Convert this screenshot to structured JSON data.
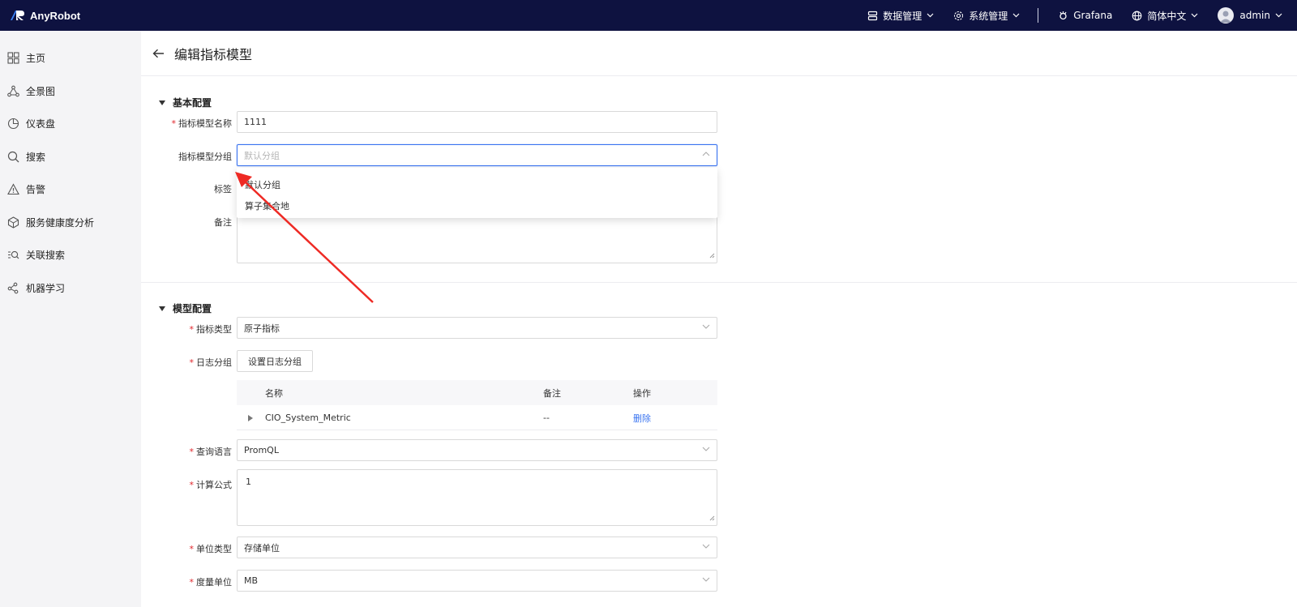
{
  "app": {
    "name": "AnyRobot",
    "brand_color": "#0e1240",
    "accent_color": "#3a74f0",
    "required_color": "#e0262b"
  },
  "topnav": {
    "data_mgmt": "数据管理",
    "sys_mgmt": "系统管理",
    "grafana": "Grafana",
    "language": "简体中文",
    "user": "admin"
  },
  "sidebar": {
    "items": [
      {
        "label": "主页",
        "icon": "grid-icon"
      },
      {
        "label": "全景图",
        "icon": "topology-icon"
      },
      {
        "label": "仪表盘",
        "icon": "pie-chart-icon"
      },
      {
        "label": "搜索",
        "icon": "search-icon"
      },
      {
        "label": "告警",
        "icon": "warning-icon"
      },
      {
        "label": "服务健康度分析",
        "icon": "cube-icon"
      },
      {
        "label": "关联搜索",
        "icon": "list-search-icon"
      },
      {
        "label": "机器学习",
        "icon": "nodes-icon"
      }
    ]
  },
  "page": {
    "title": "编辑指标模型"
  },
  "basic": {
    "section_title": "基本配置",
    "name_label": "指标模型名称",
    "name_value": "1111",
    "group_label": "指标模型分组",
    "group_placeholder": "默认分组",
    "group_options": [
      "默认分组",
      "算子集合地"
    ],
    "tags_label": "标签",
    "remark_label": "备注"
  },
  "model": {
    "section_title": "模型配置",
    "type_label": "指标类型",
    "type_value": "原子指标",
    "log_group_label": "日志分组",
    "log_group_button": "设置日志分组",
    "table": {
      "headers": [
        "名称",
        "备注",
        "操作"
      ],
      "rows": [
        {
          "name": "CIO_System_Metric",
          "remark": "--",
          "action": "删除"
        }
      ]
    },
    "query_lang_label": "查询语言",
    "query_lang_value": "PromQL",
    "formula_label": "计算公式",
    "formula_value": "1",
    "unit_type_label": "单位类型",
    "unit_type_value": "存储单位",
    "measure_unit_label": "度量单位",
    "measure_unit_value": "MB"
  }
}
